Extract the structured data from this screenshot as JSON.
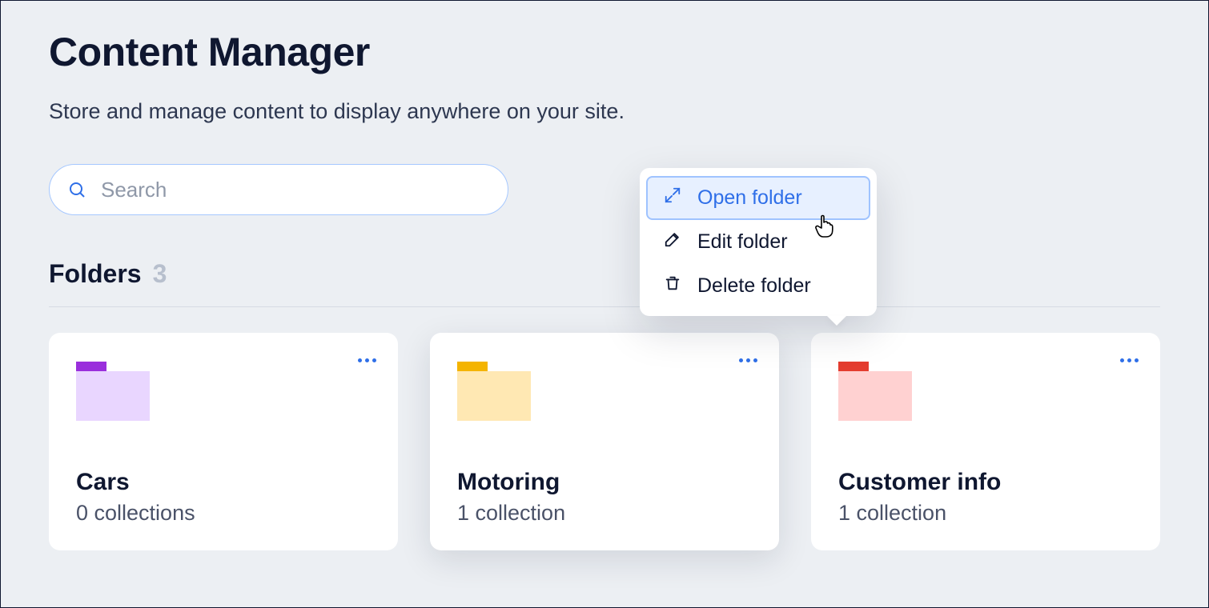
{
  "header": {
    "title": "Content Manager",
    "subtitle": "Store and manage content to display anywhere on your site."
  },
  "search": {
    "placeholder": "Search",
    "value": ""
  },
  "folders_section": {
    "title": "Folders",
    "count": "3"
  },
  "folders": [
    {
      "name": "Cars",
      "subtitle": "0 collections",
      "color_body": "#e9d6ff",
      "color_tab": "#9a2fdc"
    },
    {
      "name": "Motoring",
      "subtitle": "1 collection",
      "color_body": "#ffe8b3",
      "color_tab": "#f4b400",
      "active": true
    },
    {
      "name": "Customer info",
      "subtitle": "1 collection",
      "color_body": "#ffd1d1",
      "color_tab": "#e43c2f"
    }
  ],
  "context_menu": {
    "items": [
      {
        "label": "Open folder",
        "icon": "expand-icon",
        "active": true
      },
      {
        "label": "Edit folder",
        "icon": "pencil-icon"
      },
      {
        "label": "Delete folder",
        "icon": "trash-icon"
      }
    ]
  }
}
